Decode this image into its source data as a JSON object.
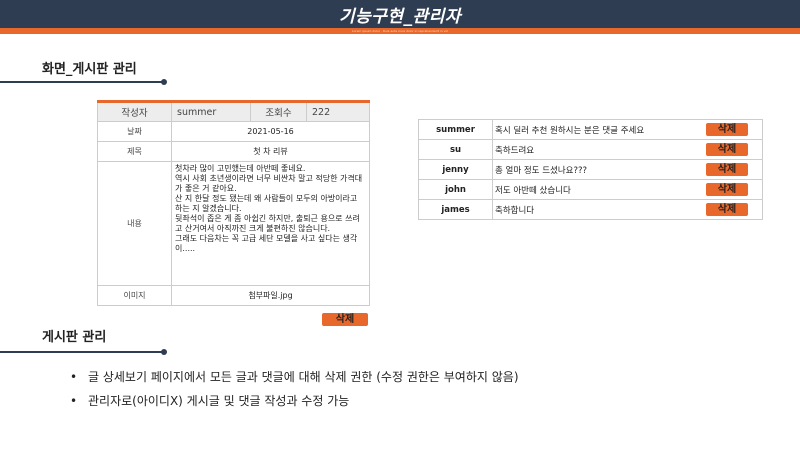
{
  "header": {
    "title": "기능구현_관리자",
    "subtitle": "Lorem ipsum dolor · Duis aute irure dolor in reprehenderit in vol"
  },
  "section1": {
    "title": "화면_게시판 관리"
  },
  "section2": {
    "title": "게시판 관리"
  },
  "post": {
    "author_label": "작성자",
    "author_value": "summer",
    "views_label": "조회수",
    "views_value": "222",
    "date_label": "날짜",
    "date_value": "2021-05-16",
    "title_label": "제목",
    "title_value": "첫 차 리뷰",
    "content_label": "내용",
    "content_value": "첫차라 많이 고민했는데 아반떼 좋네요.\n역시 사회 초년생이라면 너무 비싼차 말고 적당한 가격대가 좋은 거 같아요.\n산 지 한달 정도 됐는데 왜 사람들이 모두의 아방이라고 하는 지 알겠습니다.\n뒷좌석이 좁은 게 좀 아쉽긴 하지만, 출퇴근 용으로 쓰려고 산거여서 아직까진 크게 불편하진 않습니다.\n그래도 다음차는 꼭 고급 세단 모델을 사고 싶다는 생각이.....",
    "image_label": "이미지",
    "image_value": "첨부파일.jpg",
    "delete_label": "삭제"
  },
  "comments": [
    {
      "user": "summer",
      "text": "혹시 딜러 추천 원하시는 분은 댓글 주세요",
      "delete_label": "삭제"
    },
    {
      "user": "su",
      "text": "축하드려요",
      "delete_label": "삭제"
    },
    {
      "user": "jenny",
      "text": "총 얼마 정도 드셨나요???",
      "delete_label": "삭제"
    },
    {
      "user": "john",
      "text": "저도 아반떼 샀습니다",
      "delete_label": "삭제"
    },
    {
      "user": "james",
      "text": "축하합니다",
      "delete_label": "삭제"
    }
  ],
  "bullets": [
    "글 상세보기 페이지에서 모든 글과 댓글에 대해 삭제 권한 (수정 권한은 부여하지 않음)",
    "관리자로(아이디X) 게시글 및 댓글 작성과 수정 가능"
  ],
  "colors": {
    "accent": "#e8672a",
    "navy": "#2f3d52"
  }
}
